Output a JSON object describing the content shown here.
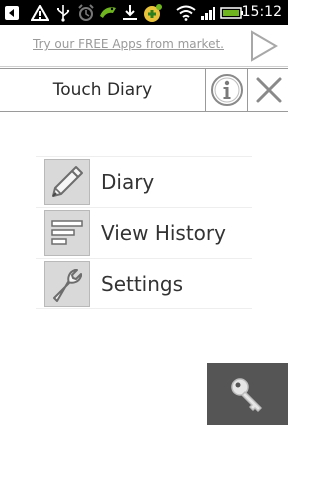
{
  "status_bar": {
    "time": "15:12",
    "icons": [
      "back-notification-icon",
      "warning-icon",
      "usb-icon",
      "alarm-icon",
      "android-icon",
      "download-icon",
      "app-notification-icon",
      "wifi-icon",
      "signal-icon",
      "battery-icon"
    ]
  },
  "ad": {
    "text": "Try our FREE Apps from market.",
    "icon": "play-arrow-icon"
  },
  "header": {
    "title": "Touch Diary",
    "info_icon": "info-icon",
    "close_icon": "close-icon"
  },
  "menu": {
    "items": [
      {
        "label": "Diary",
        "icon": "pencil-icon"
      },
      {
        "label": "View History",
        "icon": "list-icon"
      },
      {
        "label": "Settings",
        "icon": "wrench-icon"
      }
    ]
  },
  "lock_button": {
    "icon": "key-icon"
  },
  "colors": {
    "status_bar": "#000000",
    "ad_text": "#9a9a9a",
    "title_text": "#2b2b2b",
    "menu_icon_bg": "#d9d9d9",
    "key_button_bg": "#555555"
  }
}
